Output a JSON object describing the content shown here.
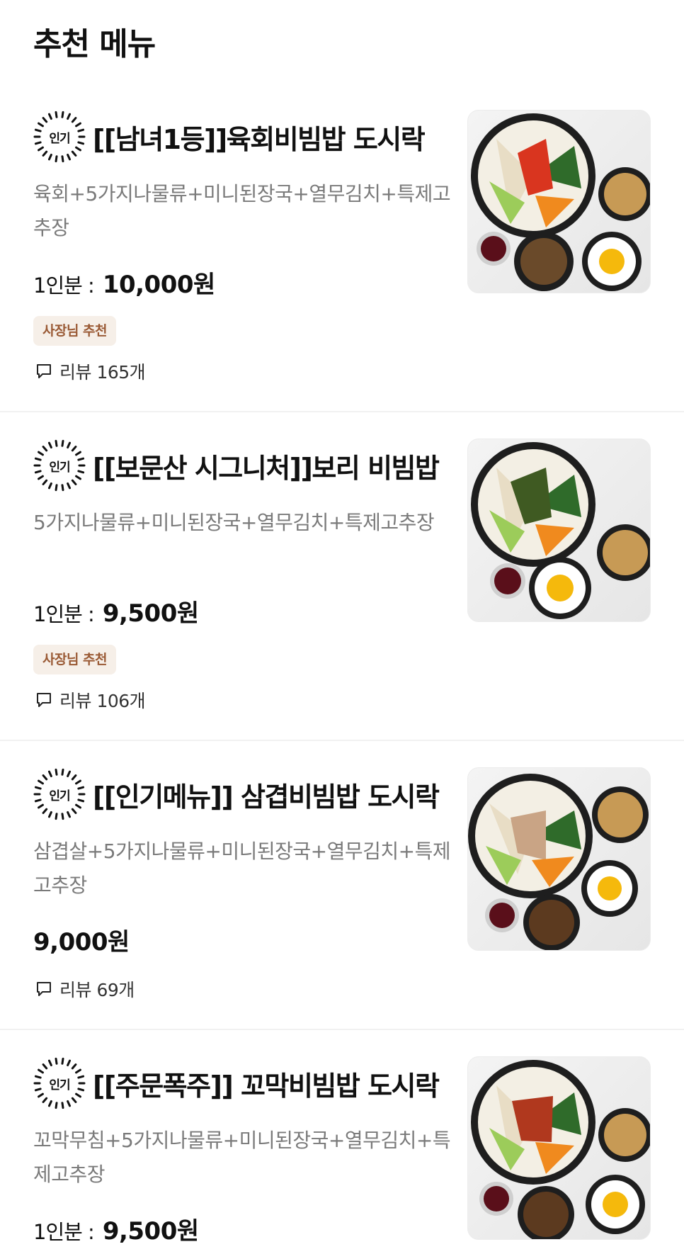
{
  "section": {
    "title": "추천 메뉴"
  },
  "popular_badge_text": "인기",
  "price_unit_label": "1인분 :",
  "owner_pick_label": "사장님 추천",
  "items": [
    {
      "name": "[[남녀1등]]육회비빔밥 도시락",
      "desc": "육회+5가지나물류+미니된장국+열무김치+특제고추장",
      "price": "10,000원",
      "has_unit_label": true,
      "owner_pick": true,
      "reviews": "리뷰 165개",
      "image": "yukhoe-bibimbap-lunchbox-photo"
    },
    {
      "name": "[[보문산 시그니처]]보리 비빔밥",
      "desc": "5가지나물류+미니된장국+열무김치+특제고추장",
      "price": "9,500원",
      "has_unit_label": true,
      "owner_pick": true,
      "reviews": "리뷰 106개",
      "image": "barley-bibimbap-photo"
    },
    {
      "name": "[[인기메뉴]] 삼겹비빔밥 도시락",
      "desc": "삼겹살+5가지나물류+미니된장국+열무김치+특제고추장",
      "price": "9,000원",
      "has_unit_label": false,
      "owner_pick": false,
      "reviews": "리뷰 69개",
      "image": "pork-belly-bibimbap-photo"
    },
    {
      "name": "[[주문폭주]] 꼬막비빔밥 도시락",
      "desc": "꼬막무침+5가지나물류+미니된장국+열무김치+특제고추장",
      "price": "9,500원",
      "has_unit_label": true,
      "owner_pick": false,
      "reviews": null,
      "image": "cockle-bibimbap-photo"
    }
  ]
}
